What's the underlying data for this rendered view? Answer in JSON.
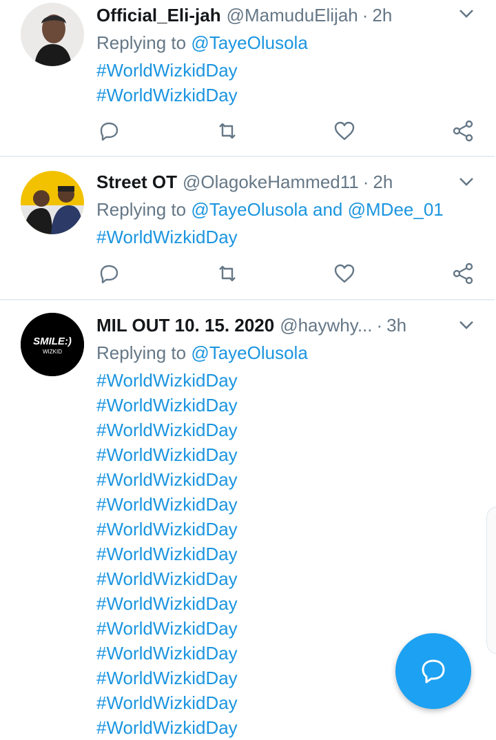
{
  "tweets": [
    {
      "name": "Official_Eli-jah",
      "handle": "@MamuduElijah",
      "separator": "·",
      "time": "2h",
      "reply_prefix": "Replying to",
      "reply_to": "@TayeOlusola",
      "lines": [
        "#WorldWizkidDay",
        "#WorldWizkidDay"
      ]
    },
    {
      "name": "Street OT",
      "handle": "@OlagokeHammed11",
      "separator": "·",
      "time": "2h",
      "reply_prefix": "Replying to",
      "reply_to": "@TayeOlusola and @MDee_01",
      "lines": [
        "#WorldWizkidDay"
      ]
    },
    {
      "name": "MIL OUT 10. 15. 2020",
      "handle": "@haywhy...",
      "separator": "·",
      "time": "3h",
      "reply_prefix": "Replying to",
      "reply_to": "@TayeOlusola",
      "avatar_text": "SMILE:)",
      "avatar_subtext": "WIZKID",
      "lines": [
        "#WorldWizkidDay",
        "#WorldWizkidDay",
        "#WorldWizkidDay",
        "#WorldWizkidDay",
        "#WorldWizkidDay",
        "#WorldWizkidDay",
        "#WorldWizkidDay",
        "#WorldWizkidDay",
        "#WorldWizkidDay",
        "#WorldWizkidDay",
        "#WorldWizkidDay",
        "#WorldWizkidDay",
        "#WorldWizkidDay",
        "#WorldWizkidDay",
        "#WorldWizkidDay"
      ]
    }
  ],
  "action_icons": [
    "reply-icon",
    "retweet-icon",
    "like-icon",
    "share-icon"
  ],
  "fab_icon": "compose-reply-icon",
  "colors": {
    "accent": "#1da1f2",
    "link": "#1b95e0",
    "muted": "#657786",
    "text": "#14171a",
    "divider": "#e6ecf0"
  }
}
